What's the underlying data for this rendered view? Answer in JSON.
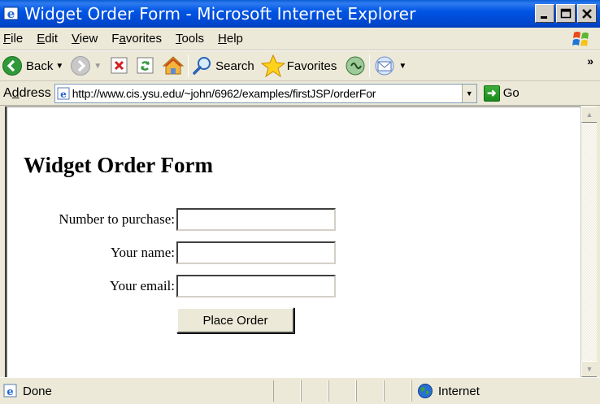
{
  "window": {
    "title": "Widget Order Form - Microsoft Internet Explorer",
    "minimize_glyph": "_",
    "maximize_glyph": "□",
    "close_glyph": "x"
  },
  "menu": [
    {
      "label": "File",
      "accel": "F",
      "rest": "ile"
    },
    {
      "label": "Edit",
      "accel": "E",
      "rest": "dit"
    },
    {
      "label": "View",
      "accel": "V",
      "rest": "iew"
    },
    {
      "label": "Favorites",
      "accel": "a",
      "pre": "F",
      "rest": "vorites"
    },
    {
      "label": "Tools",
      "accel": "T",
      "rest": "ools"
    },
    {
      "label": "Help",
      "accel": "H",
      "rest": "elp"
    }
  ],
  "toolbar": {
    "back_label": "Back",
    "search_label": "Search",
    "favorites_label": "Favorites",
    "more_glyph": "»"
  },
  "address": {
    "label_pre": "A",
    "label_accel": "d",
    "label_rest": "dress",
    "url": "http://www.cis.ysu.edu/~john/6962/examples/firstJSP/orderFor",
    "go_label": "Go"
  },
  "page": {
    "heading": "Widget Order Form",
    "fields": [
      {
        "label": "Number to purchase:",
        "value": ""
      },
      {
        "label": "Your name:",
        "value": ""
      },
      {
        "label": "Your email:",
        "value": ""
      }
    ],
    "submit_label": "Place Order"
  },
  "status": {
    "text": "Done",
    "zone": "Internet"
  },
  "colors": {
    "titlebar": "#0055e5",
    "chrome": "#ece9d8",
    "content_bg": "#ffffff"
  }
}
